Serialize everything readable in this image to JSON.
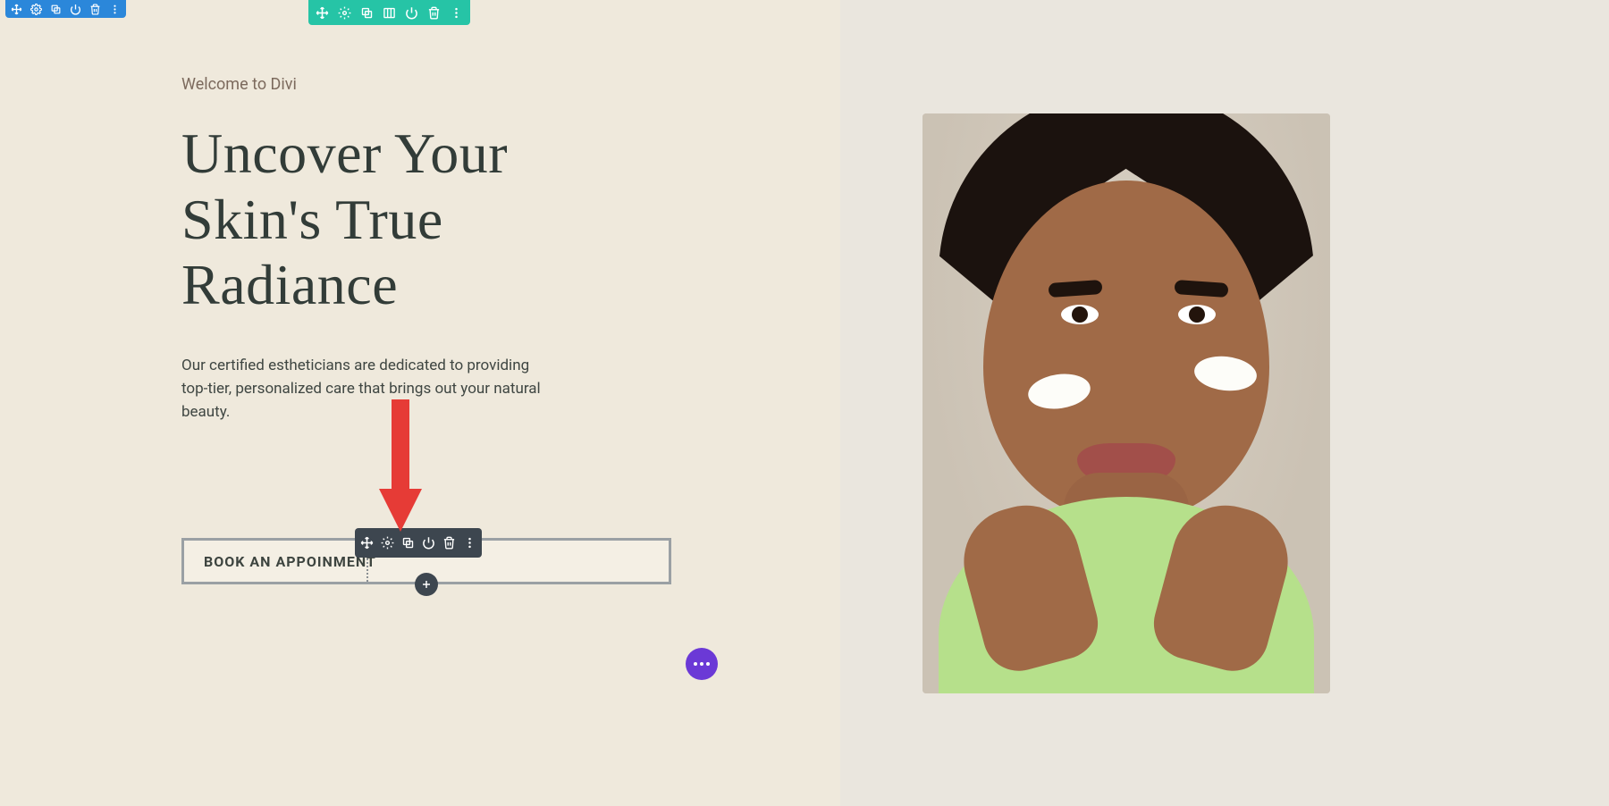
{
  "hero": {
    "subtitle": "Welcome to Divi",
    "title": "Uncover Your Skin's True Radiance",
    "body": "Our certified estheticians are dedicated to providing top-tier, personalized care that brings out your natural beauty.",
    "button_label": "BOOK AN APPOINMENT"
  },
  "toolbars": {
    "section_color": "#2b87da",
    "row_color": "#26c4a6",
    "module_color": "#3d464f",
    "icons": [
      "move",
      "settings",
      "duplicate",
      "columns",
      "power",
      "trash",
      "more"
    ],
    "section_icons": [
      "move",
      "settings",
      "duplicate",
      "power",
      "trash",
      "more"
    ],
    "module_icons": [
      "move",
      "settings",
      "duplicate",
      "power",
      "trash",
      "more"
    ]
  },
  "fab": {
    "color": "#6b39d6"
  },
  "image": {
    "alt": "smiling woman with skincare cream on cheeks"
  }
}
